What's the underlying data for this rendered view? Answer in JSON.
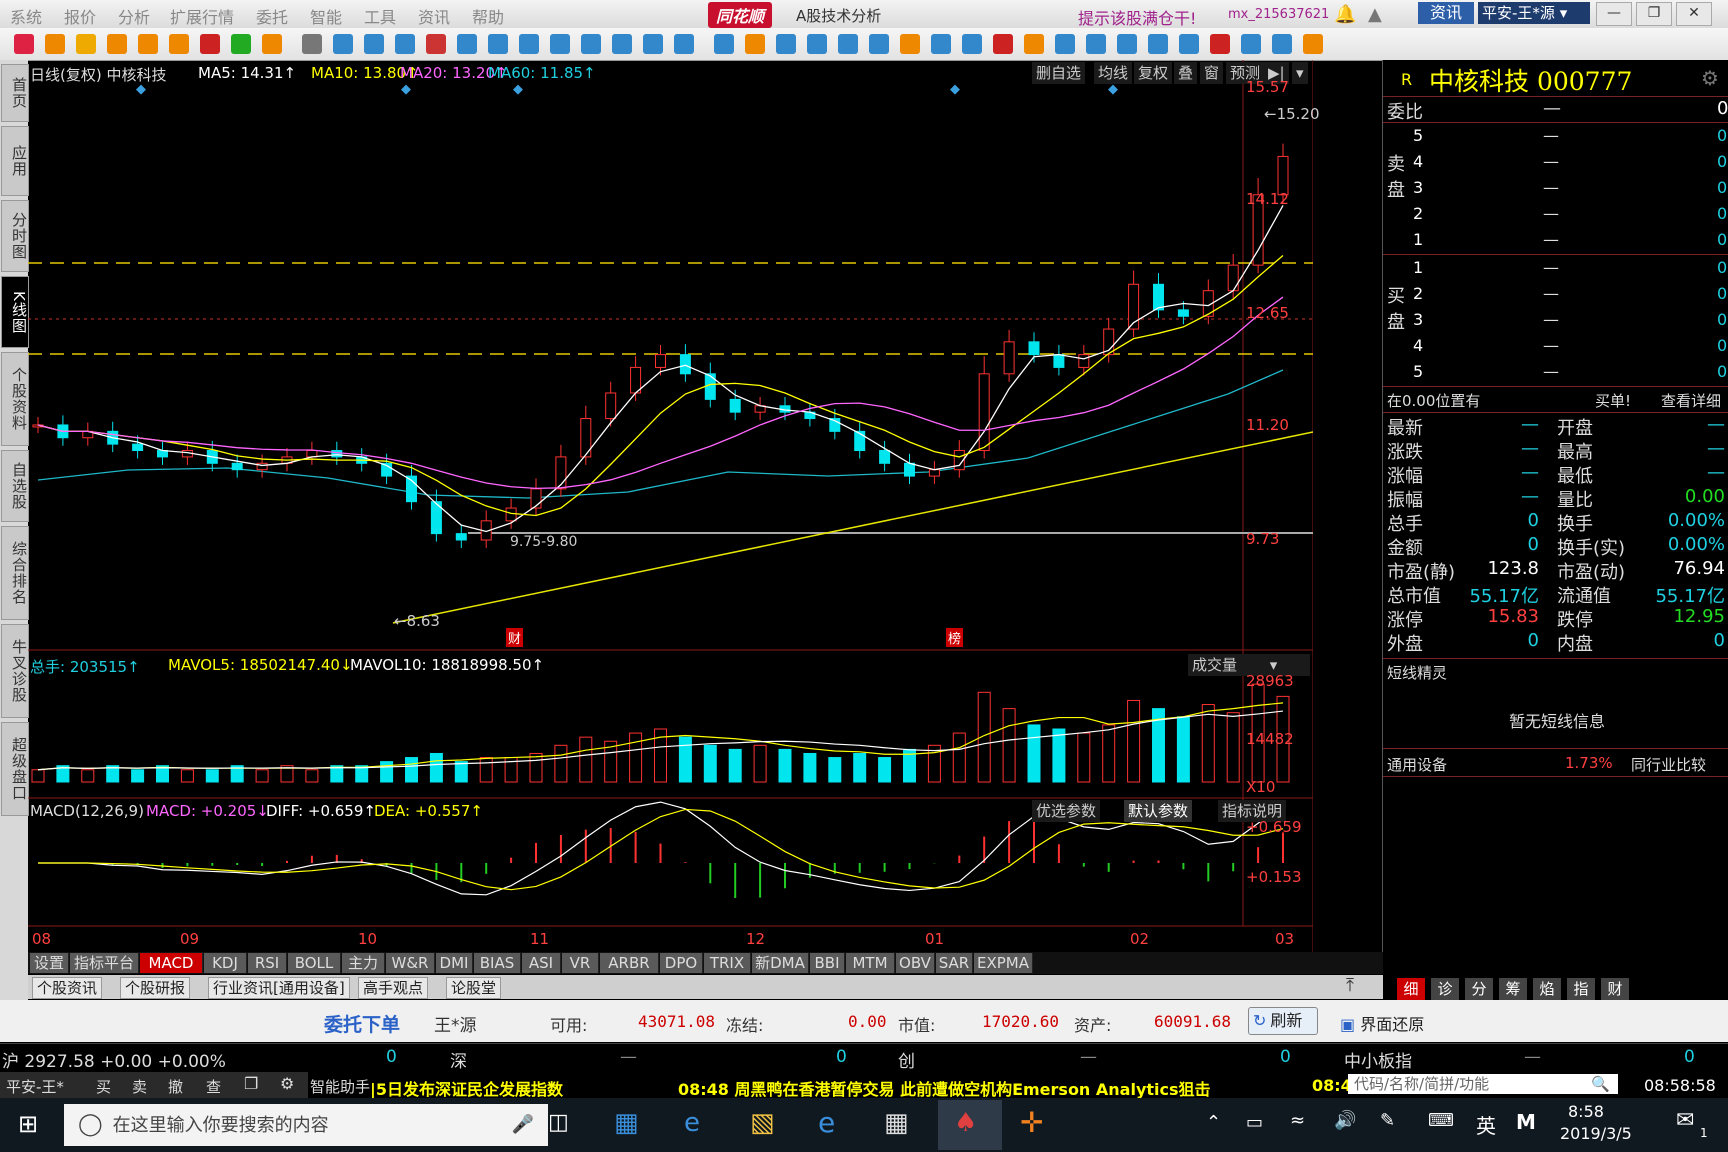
{
  "menu": [
    "系统",
    "报价",
    "分析",
    "扩展行情",
    "委托",
    "智能",
    "工具",
    "资讯",
    "帮助"
  ],
  "brand": "同花顺",
  "app_title": "A股技术分析",
  "promo": "提示该股满仓干!",
  "account": "mx_215637621",
  "zixun_label": "资讯",
  "broker_select": "平安-王*源",
  "left_tabs": [
    "首页",
    "应用",
    "分时图",
    "K线图",
    "个股资料",
    "自选股",
    "综合排名",
    "牛叉诊股",
    "超级盘口"
  ],
  "chart": {
    "header": "日线(复权)  中核科技",
    "ma5": "MA5: 14.31↑",
    "ma10": "MA10: 13.80↑",
    "ma20": "MA20: 13.20↑",
    "ma60": "MA60: 11.85↑",
    "controls": [
      "删自选",
      "均线",
      "复权",
      "叠",
      "窗",
      "预测"
    ],
    "price_axis": [
      "15.57",
      "14.12",
      "12.65",
      "11.20",
      "9.73"
    ],
    "high_note": "15.20",
    "low_note": "8.63",
    "range_note": "9.75-9.80",
    "event_marks": [
      "财",
      "榜"
    ],
    "months": [
      "08",
      "09",
      "10",
      "11",
      "12",
      "01",
      "02",
      "03"
    ],
    "vol_header": {
      "total": "总手: 203515↑",
      "mavol5": "MAVOL5: 18502147.40↓",
      "mavol10": "MAVOL10: 18818998.50↑"
    },
    "vol_select": "成交量",
    "vol_axis": [
      "28963",
      "14482",
      "X10"
    ],
    "macd_header": {
      "name": "MACD(12,26,9)",
      "macd": "MACD: +0.205↓",
      "diff": "DIFF: +0.659↑",
      "dea": "DEA: +0.557↑"
    },
    "macd_buttons": [
      "优选参数",
      "默认参数",
      "指标说明"
    ],
    "macd_axis": [
      "+0.659",
      "+0.153"
    ]
  },
  "chart_data": {
    "type": "candlestick",
    "title": "日线(复权)  中核科技",
    "categories": [
      "08",
      "09",
      "10",
      "11",
      "12",
      "01",
      "02",
      "03"
    ],
    "ylim": [
      8.0,
      16.0
    ],
    "closes": [
      10.8,
      10.6,
      10.7,
      10.5,
      10.4,
      10.3,
      10.4,
      10.2,
      10.1,
      10.2,
      10.3,
      10.4,
      10.3,
      10.2,
      10.0,
      9.6,
      9.1,
      9.0,
      9.3,
      9.5,
      9.8,
      10.3,
      10.9,
      11.3,
      11.7,
      11.9,
      11.6,
      11.2,
      11.0,
      11.1,
      11.0,
      10.9,
      10.7,
      10.4,
      10.2,
      10.0,
      10.1,
      10.4,
      11.6,
      12.1,
      11.9,
      11.7,
      11.9,
      12.3,
      13.0,
      12.6,
      12.5,
      12.9,
      13.3,
      14.4,
      15.0
    ],
    "ma_series": [
      {
        "name": "MA5",
        "color": "#ffffff"
      },
      {
        "name": "MA10",
        "color": "#ffff00"
      },
      {
        "name": "MA20",
        "color": "#ff66ff"
      },
      {
        "name": "MA60",
        "color": "#00ffff"
      }
    ],
    "volume": [
      3,
      4,
      3,
      4,
      3,
      4,
      3,
      3,
      4,
      3,
      4,
      3,
      4,
      4,
      5,
      6,
      7,
      5,
      6,
      6,
      7,
      9,
      11,
      10,
      12,
      13,
      11,
      9,
      8,
      9,
      8,
      7,
      6,
      7,
      6,
      8,
      9,
      12,
      22,
      18,
      14,
      13,
      12,
      14,
      20,
      18,
      16,
      19,
      17,
      24,
      21
    ]
  },
  "quote": {
    "name": "中核科技 000777",
    "weibi_label": "委比",
    "weibi_dash": "—",
    "weibi_val": "0",
    "sell_label": "卖盘",
    "buy_label": "买盘",
    "levels": [
      "5",
      "4",
      "3",
      "2",
      "1"
    ],
    "buy_levels": [
      "1",
      "2",
      "3",
      "4",
      "5"
    ],
    "dash": "—",
    "zero": "0",
    "position_note": "在0.00位置有",
    "buy_btn": "买单!",
    "detail_link": "查看详细",
    "stats_left": [
      {
        "k": "最新",
        "v": "—"
      },
      {
        "k": "涨跌",
        "v": "—"
      },
      {
        "k": "涨幅",
        "v": "—"
      },
      {
        "k": "振幅",
        "v": "—"
      },
      {
        "k": "总手",
        "v": "0"
      },
      {
        "k": "金额",
        "v": "0"
      },
      {
        "k": "市盈(静)",
        "v": "123.8"
      },
      {
        "k": "总市值",
        "v": "55.17亿"
      },
      {
        "k": "涨停",
        "v": "15.83"
      },
      {
        "k": "外盘",
        "v": "0"
      }
    ],
    "stats_right": [
      {
        "k": "开盘",
        "v": "—"
      },
      {
        "k": "最高",
        "v": "—"
      },
      {
        "k": "最低",
        "v": "—"
      },
      {
        "k": "量比",
        "v": "0.00"
      },
      {
        "k": "换手",
        "v": "0.00%"
      },
      {
        "k": "换手(实)",
        "v": "0.00%"
      },
      {
        "k": "市盈(动)",
        "v": "76.94"
      },
      {
        "k": "流通值",
        "v": "55.17亿"
      },
      {
        "k": "跌停",
        "v": "12.95"
      },
      {
        "k": "内盘",
        "v": "0"
      }
    ],
    "short_title": "短线精灵",
    "short_msg": "暂无短线信息",
    "sector": "通用设备",
    "sector_pct": "1.73%",
    "sector_compare": "同行业比较",
    "bottom_tabs": [
      "细",
      "诊",
      "分",
      "筹",
      "焰",
      "指",
      "财"
    ]
  },
  "indicator_tabs": [
    "设置",
    "指标平台",
    "MACD",
    "KDJ",
    "RSI",
    "BOLL",
    "主力",
    "W&R",
    "DMI",
    "BIAS",
    "ASI",
    "VR",
    "ARBR",
    "DPO",
    "TRIX",
    "新DMA",
    "BBI",
    "MTM",
    "OBV",
    "SAR",
    "EXPMA"
  ],
  "info_tabs": [
    "个股资讯",
    "个股研报",
    "行业资讯[通用设备]",
    "高手观点",
    "论股堂"
  ],
  "order": {
    "title": "委托下单",
    "user": "王*源",
    "avail_label": "可用:",
    "avail": "43071.08",
    "frozen_label": "冻结:",
    "frozen": "0.00",
    "mktval_label": "市值:",
    "mktval": "17020.60",
    "asset_label": "资产:",
    "asset": "60091.68",
    "refresh": "刷新",
    "restore": "界面还原"
  },
  "indexbar": {
    "hu": "沪",
    "hu_val": "2927.58",
    "hu_chg": "+0.00",
    "hu_pct": "+0.00%",
    "zero": "0",
    "shen": "深",
    "chuang": "创",
    "small": "中小板指",
    "dash": "—"
  },
  "newsbar": {
    "account": "平安-王*",
    "actions": [
      "买",
      "卖",
      "撤",
      "查"
    ],
    "assistant": "智能助手",
    "news1": "|5日发布深证民企发展指数",
    "news2": "08:48 周黑鸭在香港暂停交易 此前遭做空机构Emerson Analytics狙击",
    "news3": "08:4",
    "search_placeholder": "代码/名称/简拼/功能",
    "clock": "08:58:58"
  },
  "taskbar": {
    "search": "在这里输入你要搜索的内容",
    "lang": "英",
    "time": "8:58",
    "date": "2019/3/5",
    "notify_count": "1"
  }
}
